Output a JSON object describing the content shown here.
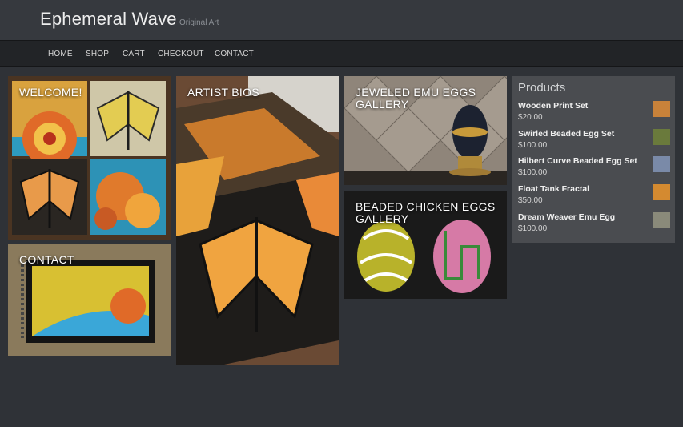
{
  "header": {
    "site_title": "Ephemeral Wave",
    "tagline": "Original Art"
  },
  "nav": {
    "items": [
      {
        "label": "HOME"
      },
      {
        "label": "SHOP"
      },
      {
        "label": "CART"
      },
      {
        "label": "CHECKOUT"
      },
      {
        "label": "CONTACT"
      }
    ]
  },
  "tiles": {
    "welcome": "WELCOME!",
    "contact": "CONTACT",
    "artist_bios": "ARTIST BIOS",
    "emu_eggs": "JEWELED EMU EGGS GALLERY",
    "chicken_eggs": "BEADED CHICKEN EGGS GALLERY"
  },
  "products": {
    "title": "Products",
    "items": [
      {
        "name": "Wooden Print Set",
        "price": "$20.00",
        "thumb_color": "#c8823a"
      },
      {
        "name": "Swirled Beaded Egg Set",
        "price": "$100.00",
        "thumb_color": "#6a7a3c"
      },
      {
        "name": "Hilbert Curve Beaded Egg Set",
        "price": "$100.00",
        "thumb_color": "#7a8aa8"
      },
      {
        "name": "Float Tank Fractal",
        "price": "$50.00",
        "thumb_color": "#d48a30"
      },
      {
        "name": "Dream Weaver Emu Egg",
        "price": "$100.00",
        "thumb_color": "#8a8a7a"
      }
    ]
  },
  "colors": {
    "background": "#2f3237",
    "header": "#36393e",
    "nav": "#222427",
    "sidebar": "#4a4c50"
  }
}
